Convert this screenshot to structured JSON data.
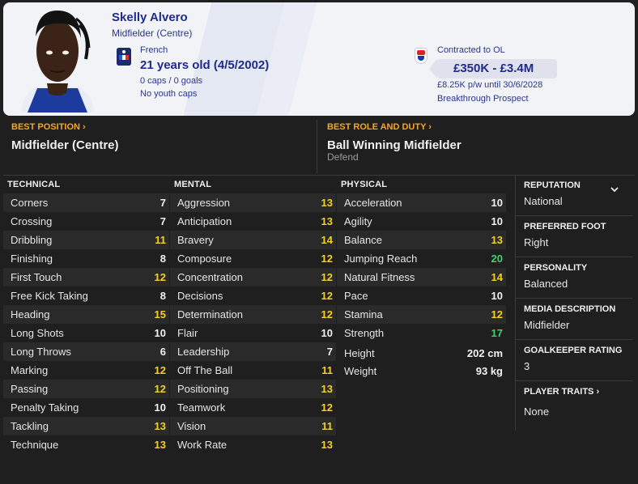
{
  "player": {
    "name": "Skelly Alvero",
    "position": "Midfielder (Centre)",
    "nationality": "French",
    "age": "21 years old (4/5/2002)",
    "caps": "0 caps / 0 goals",
    "youth_caps": "No youth caps",
    "contract": "Contracted to OL",
    "value": "£350K - £3.4M",
    "wage": "£8.25K p/w until 30/6/2028",
    "status": "Breakthrough Prospect"
  },
  "best_position": {
    "label": "BEST POSITION ›",
    "value": "Midfielder (Centre)"
  },
  "best_role": {
    "label": "BEST ROLE AND DUTY ›",
    "value": "Ball Winning Midfielder",
    "duty": "Defend"
  },
  "technical": {
    "header": "TECHNICAL",
    "items": [
      {
        "name": "Corners",
        "value": "7"
      },
      {
        "name": "Crossing",
        "value": "7"
      },
      {
        "name": "Dribbling",
        "value": "11"
      },
      {
        "name": "Finishing",
        "value": "8"
      },
      {
        "name": "First Touch",
        "value": "12"
      },
      {
        "name": "Free Kick Taking",
        "value": "8"
      },
      {
        "name": "Heading",
        "value": "15"
      },
      {
        "name": "Long Shots",
        "value": "10"
      },
      {
        "name": "Long Throws",
        "value": "6"
      },
      {
        "name": "Marking",
        "value": "12"
      },
      {
        "name": "Passing",
        "value": "12"
      },
      {
        "name": "Penalty Taking",
        "value": "10"
      },
      {
        "name": "Tackling",
        "value": "13"
      },
      {
        "name": "Technique",
        "value": "13"
      }
    ]
  },
  "mental": {
    "header": "MENTAL",
    "items": [
      {
        "name": "Aggression",
        "value": "13"
      },
      {
        "name": "Anticipation",
        "value": "13"
      },
      {
        "name": "Bravery",
        "value": "14"
      },
      {
        "name": "Composure",
        "value": "12"
      },
      {
        "name": "Concentration",
        "value": "12"
      },
      {
        "name": "Decisions",
        "value": "12"
      },
      {
        "name": "Determination",
        "value": "12"
      },
      {
        "name": "Flair",
        "value": "10"
      },
      {
        "name": "Leadership",
        "value": "7"
      },
      {
        "name": "Off The Ball",
        "value": "11"
      },
      {
        "name": "Positioning",
        "value": "13"
      },
      {
        "name": "Teamwork",
        "value": "12"
      },
      {
        "name": "Vision",
        "value": "11"
      },
      {
        "name": "Work Rate",
        "value": "13"
      }
    ]
  },
  "physical": {
    "header": "PHYSICAL",
    "items": [
      {
        "name": "Acceleration",
        "value": "10"
      },
      {
        "name": "Agility",
        "value": "10"
      },
      {
        "name": "Balance",
        "value": "13"
      },
      {
        "name": "Jumping Reach",
        "value": "20"
      },
      {
        "name": "Natural Fitness",
        "value": "14"
      },
      {
        "name": "Pace",
        "value": "10"
      },
      {
        "name": "Stamina",
        "value": "12"
      },
      {
        "name": "Strength",
        "value": "17"
      }
    ],
    "height_label": "Height",
    "height": "202 cm",
    "weight_label": "Weight",
    "weight": "93 kg"
  },
  "info": {
    "reputation_label": "REPUTATION",
    "reputation": "National",
    "foot_label": "PREFERRED FOOT",
    "foot": "Right",
    "personality_label": "PERSONALITY",
    "personality": "Balanced",
    "media_label": "MEDIA DESCRIPTION",
    "media": "Midfielder",
    "gk_label": "GOALKEEPER RATING",
    "gk": "3",
    "traits_label": "PLAYER TRAITS ›",
    "traits": "None"
  },
  "colors": {
    "white_value": "#f2f2f2",
    "yellow_value": "#f2d024",
    "green_value": "#3fd46a",
    "accent_orange": "#f5a623",
    "header_navy": "#1f2a8a"
  },
  "icons": {
    "flag": "france-flag-icon",
    "club": "ol-badge-icon",
    "expand": "chevron-down-icon"
  }
}
